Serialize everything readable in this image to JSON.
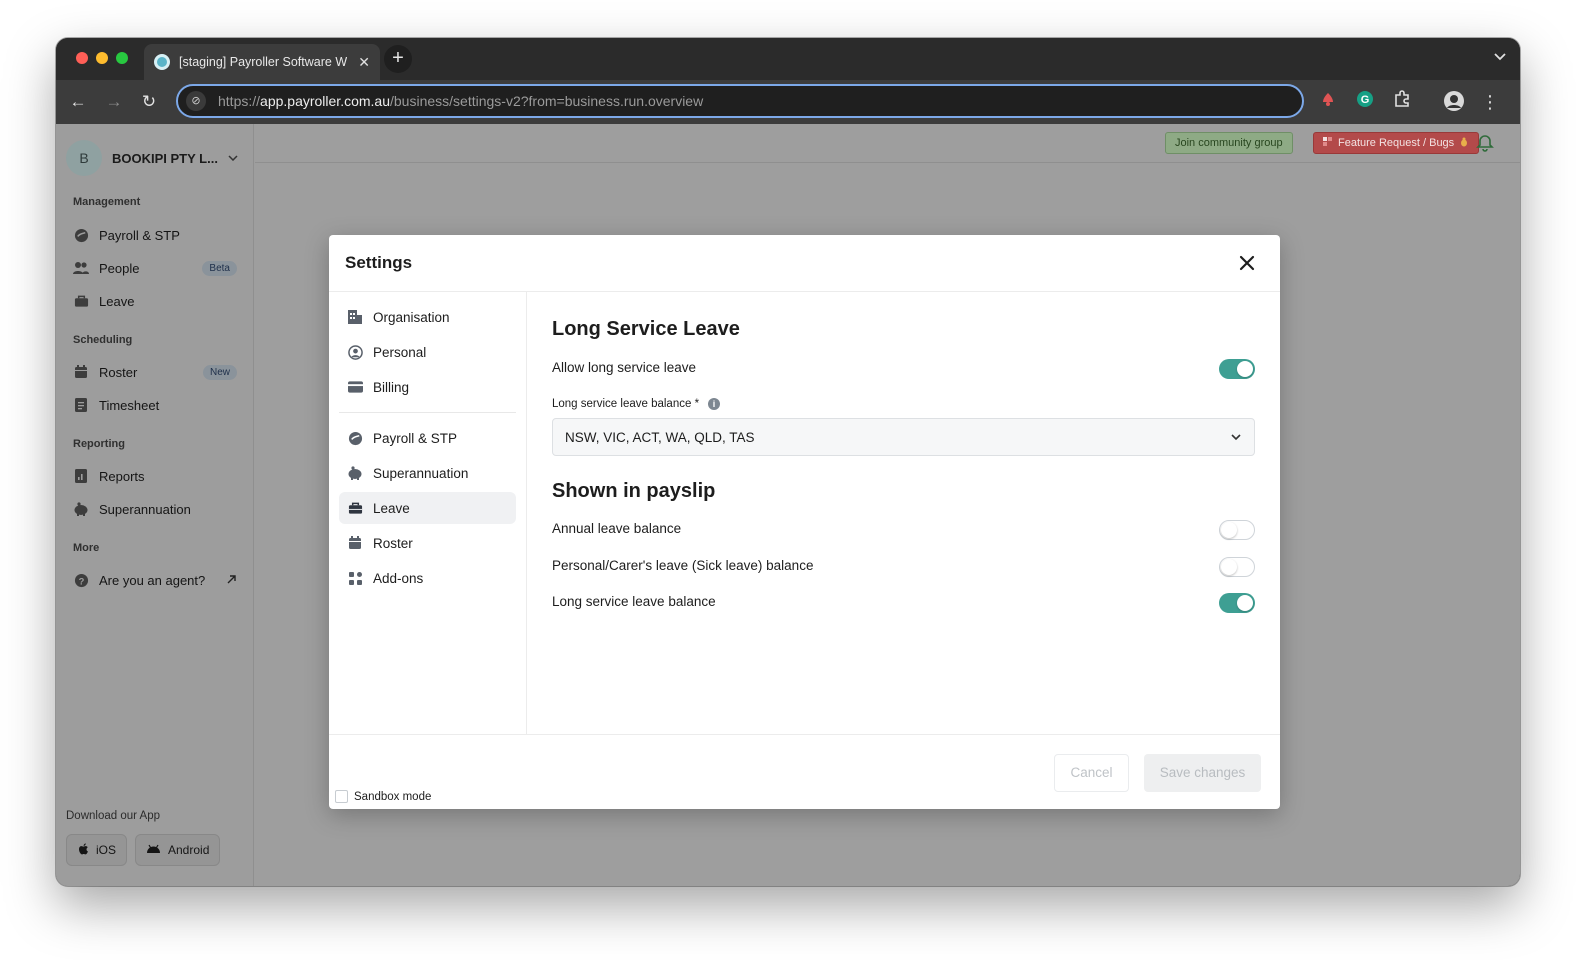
{
  "browser": {
    "tab_title": "[staging] Payroller Software W",
    "new_tab_label": "+",
    "url_scheme": "https://",
    "url_host": "app.payroller.com.au",
    "url_path": "/business/settings-v2?from=business.run.overview"
  },
  "sidebar": {
    "business_initial": "B",
    "business_name": "BOOKIPI PTY L...",
    "sections": {
      "management": "Management",
      "scheduling": "Scheduling",
      "reporting": "Reporting",
      "more": "More"
    },
    "items": [
      {
        "label": "Payroll & STP",
        "icon": "payroll-icon"
      },
      {
        "label": "People",
        "icon": "people-icon",
        "badge": "Beta"
      },
      {
        "label": "Leave",
        "icon": "briefcase-icon"
      },
      {
        "label": "Roster",
        "icon": "calendar-icon",
        "badge": "New"
      },
      {
        "label": "Timesheet",
        "icon": "timesheet-icon"
      },
      {
        "label": "Reports",
        "icon": "report-icon"
      },
      {
        "label": "Superannuation",
        "icon": "piggy-bank-icon"
      },
      {
        "label": "Are you an agent?",
        "icon": "question-icon"
      }
    ],
    "download_title": "Download our App",
    "ios_label": "iOS",
    "android_label": "Android"
  },
  "topbar": {
    "join_label": "Join community group",
    "feature_label": "Feature Request / Bugs"
  },
  "modal": {
    "title": "Settings",
    "nav": [
      {
        "label": "Organisation"
      },
      {
        "label": "Personal"
      },
      {
        "label": "Billing"
      },
      {
        "label": "Payroll & STP"
      },
      {
        "label": "Superannuation"
      },
      {
        "label": "Leave",
        "active": true
      },
      {
        "label": "Roster"
      },
      {
        "label": "Add-ons"
      }
    ],
    "long_service": {
      "heading": "Long Service Leave",
      "allow_label": "Allow long service leave",
      "allow_on": true,
      "balance_label": "Long service leave balance *",
      "balance_value": "NSW, VIC, ACT, WA, QLD, TAS"
    },
    "payslip": {
      "heading": "Shown in payslip",
      "rows": [
        {
          "label": "Annual leave balance",
          "on": false
        },
        {
          "label": "Personal/Carer's leave (Sick leave) balance",
          "on": false
        },
        {
          "label": "Long service leave balance",
          "on": true
        }
      ]
    },
    "footer": {
      "sandbox_label": "Sandbox mode",
      "cancel_label": "Cancel",
      "save_label": "Save changes"
    }
  },
  "colors": {
    "accent": "#3e9f93",
    "join_bg": "#8eaa85",
    "feature_bg": "#b34a4a"
  }
}
